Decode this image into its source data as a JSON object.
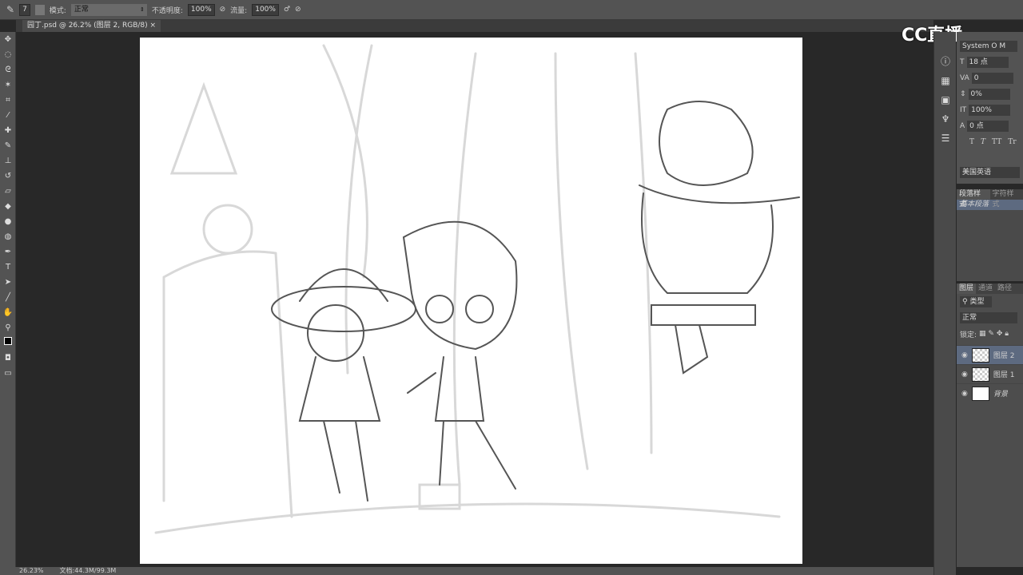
{
  "options_bar": {
    "brush_size": "7",
    "mode_label": "模式:",
    "mode_value": "正常",
    "opacity_label": "不透明度:",
    "opacity_value": "100%",
    "flow_label": "流量:",
    "flow_value": "100%"
  },
  "document_tab": {
    "title": "园丁.psd @ 26.2% (图层 2, RGB/8)",
    "close": "×"
  },
  "watermark": "CC直播",
  "character_panel": {
    "font": "System O M",
    "size": "18 点",
    "tracking": "0",
    "scale_pct": "0%",
    "vertical_scale": "100%",
    "baseline": "0 点",
    "language": "美国英语",
    "styles": [
      "T",
      "T",
      "TT",
      "Tr"
    ]
  },
  "paragraph_styles": {
    "tabs": [
      "段落样式",
      "字符样式"
    ],
    "item": "基本段落"
  },
  "layers_panel": {
    "tabs": [
      "图层",
      "通道",
      "路径"
    ],
    "filter": "类型",
    "blend": "正常",
    "lock_label": "锁定:",
    "layers": [
      {
        "name": "图层 2",
        "selected": true,
        "transparent": true
      },
      {
        "name": "图层 1",
        "selected": false,
        "transparent": true
      },
      {
        "name": "背景",
        "selected": false,
        "transparent": false
      }
    ]
  },
  "status": {
    "zoom": "26.23%",
    "doc": "文档:44.3M/99.3M"
  }
}
